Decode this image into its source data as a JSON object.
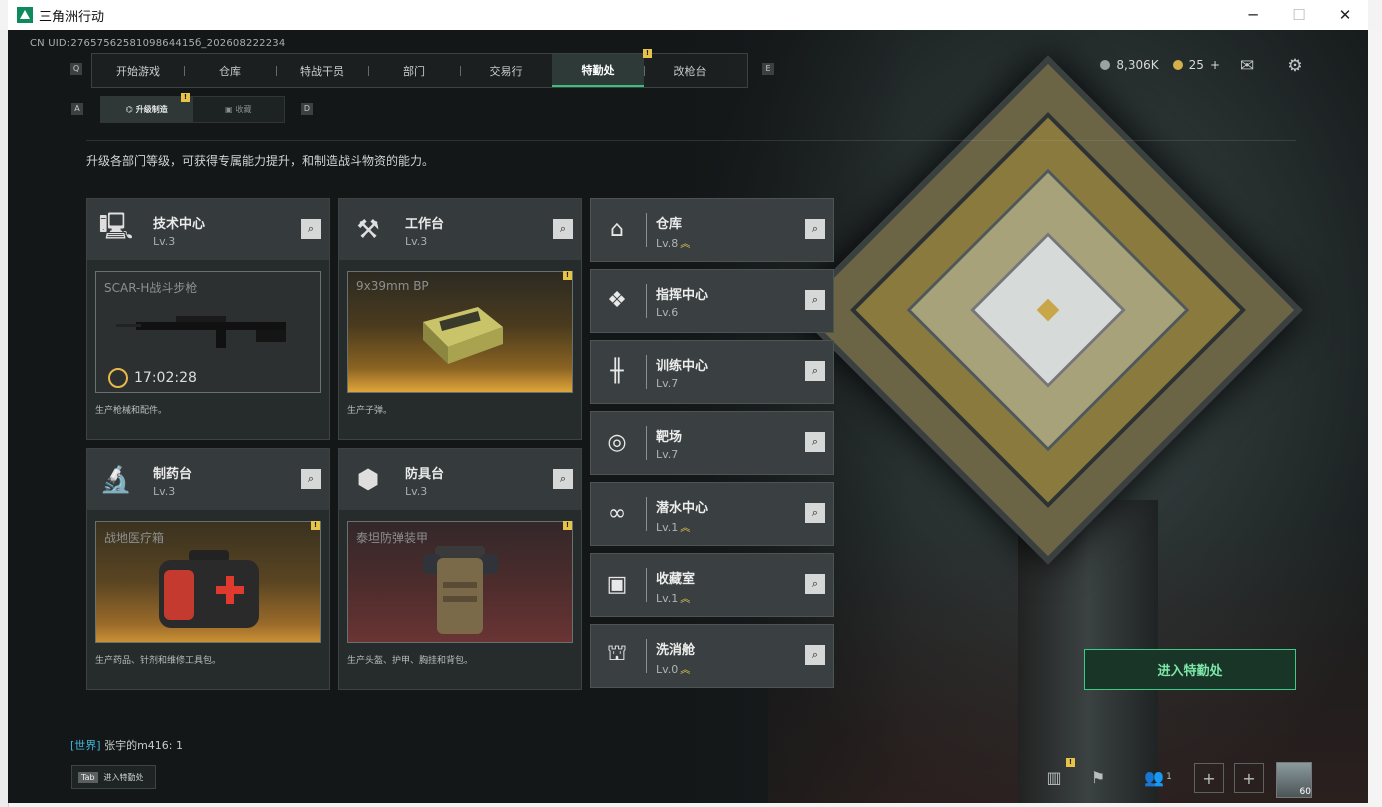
{
  "window": {
    "title": "三角洲行动",
    "minimize": "─",
    "maximize": "☐",
    "close": "✕"
  },
  "uid": "CN UID:2765756258109864415б_202608222234",
  "nav": {
    "key_left": "Q",
    "key_right": "E",
    "items": [
      "开始游戏",
      "仓库",
      "特战干员",
      "部门",
      "交易行",
      "特勤处",
      "改枪台"
    ],
    "active": "特勤处",
    "badge": "!"
  },
  "currency": {
    "amount1": "8,306K",
    "amount2": "25",
    "plus": "+"
  },
  "subnav": {
    "key_left": "A",
    "key_right": "D",
    "items": [
      "升级制造",
      "收藏"
    ],
    "badge": "!"
  },
  "intro": "升级各部门等级，可获得专属能力提升，和制造战斗物资的能力。",
  "production_cards": [
    {
      "title": "技术中心",
      "level": "Lv.3",
      "product": "SCAR-H战斗步枪",
      "timer": "17:02:28",
      "desc": "生产枪械和配件。",
      "icon": "monitor-icon"
    },
    {
      "title": "工作台",
      "level": "Lv.3",
      "product": "9x39mm BP",
      "desc": "生产子弹。",
      "icon": "tools-icon",
      "badge": "!"
    },
    {
      "title": "制药台",
      "level": "Lv.3",
      "product": "战地医疗箱",
      "desc": "生产药品、针剂和维修工具包。",
      "icon": "microscope-icon",
      "badge": "!"
    },
    {
      "title": "防具台",
      "level": "Lv.3",
      "product": "泰坦防弹装甲",
      "desc": "生产头盔、护甲、胸挂和背包。",
      "icon": "armor-blocks-icon",
      "badge": "!"
    }
  ],
  "departments": [
    {
      "title": "仓库",
      "level": "Lv.8",
      "upgradable": true,
      "icon": "warehouse-icon"
    },
    {
      "title": "指挥中心",
      "level": "Lv.6",
      "upgradable": false,
      "icon": "command-icon"
    },
    {
      "title": "训练中心",
      "level": "Lv.7",
      "upgradable": false,
      "icon": "dumbbell-icon"
    },
    {
      "title": "靶场",
      "level": "Lv.7",
      "upgradable": false,
      "icon": "target-icon"
    },
    {
      "title": "潜水中心",
      "level": "Lv.1",
      "upgradable": true,
      "icon": "diving-mask-icon"
    },
    {
      "title": "收藏室",
      "level": "Lv.1",
      "upgradable": true,
      "icon": "collection-icon"
    },
    {
      "title": "洗消舱",
      "level": "Lv.0",
      "upgradable": true,
      "icon": "decon-icon"
    }
  ],
  "upgrade_glyph": "︽",
  "enter_button": "进入特勤处",
  "chat": {
    "channel": "[世界]",
    "message": "张宇的m416: 1"
  },
  "tab_hint": {
    "key": "Tab",
    "label": "进入特勤处"
  },
  "bottom": {
    "friends_count": "1",
    "avatar_level": "60",
    "badge": "!"
  },
  "colors": {
    "accent_green": "#39c07c",
    "warning_yellow": "#e8c34a"
  }
}
